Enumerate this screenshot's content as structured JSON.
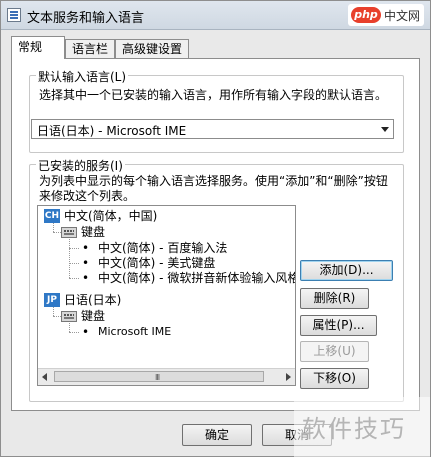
{
  "window": {
    "title": "文本服务和输入语言"
  },
  "watermark_top": {
    "logo": "php",
    "text": "中文网"
  },
  "tabs": [
    {
      "label": "常规"
    },
    {
      "label": "语言栏"
    },
    {
      "label": "高级键设置"
    }
  ],
  "default_lang": {
    "group_label": "默认输入语言(L)",
    "description": "选择其中一个已安装的输入语言，用作所有输入字段的默认语言。",
    "selected": "日语(日本) - Microsoft IME"
  },
  "installed": {
    "group_label": "已安装的服务(I)",
    "description": "为列表中显示的每个输入语言选择服务。使用“添加”和“删除”按钮来修改这个列表。",
    "tree": [
      {
        "type": "lang",
        "code": "CH",
        "label": "中文(简体，中国)"
      },
      {
        "type": "kbd",
        "label": "键盘"
      },
      {
        "type": "item",
        "label": "中文(简体) - 百度输入法"
      },
      {
        "type": "item",
        "label": "中文(简体) - 美式键盘"
      },
      {
        "type": "item",
        "label": "中文(简体) - 微软拼音新体验输入风格"
      },
      {
        "type": "lang",
        "code": "JP",
        "label": "日语(日本)"
      },
      {
        "type": "kbd",
        "label": "键盘"
      },
      {
        "type": "item",
        "label": "Microsoft IME"
      }
    ],
    "buttons": {
      "add": "添加(D)...",
      "remove": "删除(R)",
      "properties": "属性(P)...",
      "move_up": "上移(U)",
      "move_down": "下移(O)"
    },
    "scroll_grip": "III"
  },
  "footer": {
    "ok": "确定",
    "cancel": "取消"
  },
  "watermark_bottom": {
    "text": "软件技巧"
  }
}
